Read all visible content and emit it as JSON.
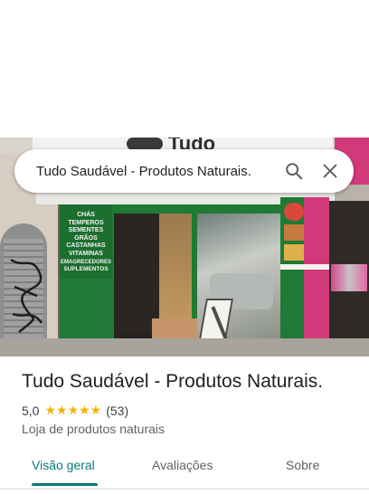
{
  "search": {
    "query": "Tudo Saudável - Produtos Naturais."
  },
  "storefront": {
    "sign_top": "Tudo",
    "side_panel": [
      "CHÁS",
      "TEMPEROS",
      "SEMENTES",
      "GRÃOS",
      "CASTANHAS",
      "VITAMINAS",
      "EMAGRECEDORES",
      "SUPLEMENTOS"
    ]
  },
  "place": {
    "name": "Tudo Saudável - Produtos Naturais.",
    "rating": "5,0",
    "stars": "★★★★★",
    "review_count": "(53)",
    "category": "Loja de produtos naturais"
  },
  "tabs": [
    {
      "label": "Visão geral",
      "active": true
    },
    {
      "label": "Avaliações",
      "active": false
    },
    {
      "label": "Sobre",
      "active": false
    }
  ],
  "colors": {
    "accent": "#0b7a75",
    "star": "#f4b400",
    "store_green": "#1e7a34"
  }
}
